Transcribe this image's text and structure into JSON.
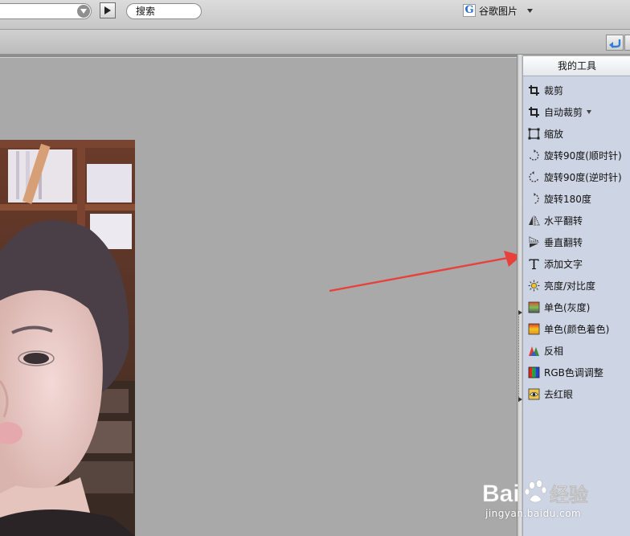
{
  "toolbar": {
    "search_label": "搜索",
    "google_label": "谷歌图片"
  },
  "panel": {
    "title": "我的工具",
    "tools": [
      {
        "label": "裁剪",
        "icon": "crop-icon"
      },
      {
        "label": "自动裁剪",
        "icon": "auto-crop-icon",
        "has_dropdown": true
      },
      {
        "label": "缩放",
        "icon": "resize-icon"
      },
      {
        "label": "旋转90度(顺时针)",
        "icon": "rotate-cw-icon"
      },
      {
        "label": "旋转90度(逆时针)",
        "icon": "rotate-ccw-icon"
      },
      {
        "label": "旋转180度",
        "icon": "rotate-180-icon"
      },
      {
        "label": "水平翻转",
        "icon": "flip-horizontal-icon"
      },
      {
        "label": "垂直翻转",
        "icon": "flip-vertical-icon"
      },
      {
        "label": "添加文字",
        "icon": "add-text-icon"
      },
      {
        "label": "亮度/对比度",
        "icon": "brightness-icon"
      },
      {
        "label": "单色(灰度)",
        "icon": "grayscale-icon"
      },
      {
        "label": "单色(颜色着色)",
        "icon": "colorize-icon"
      },
      {
        "label": "反相",
        "icon": "invert-icon"
      },
      {
        "label": "RGB色调调整",
        "icon": "rgb-adjust-icon"
      },
      {
        "label": "去红眼",
        "icon": "red-eye-icon"
      }
    ]
  },
  "watermark": {
    "brand": "Bai 经验",
    "url": "jingyan.baidu.com"
  },
  "colors": {
    "panel_bg": "#cdd4e3",
    "canvas_bg": "#a9a9a9",
    "arrow": "#e8403a"
  }
}
